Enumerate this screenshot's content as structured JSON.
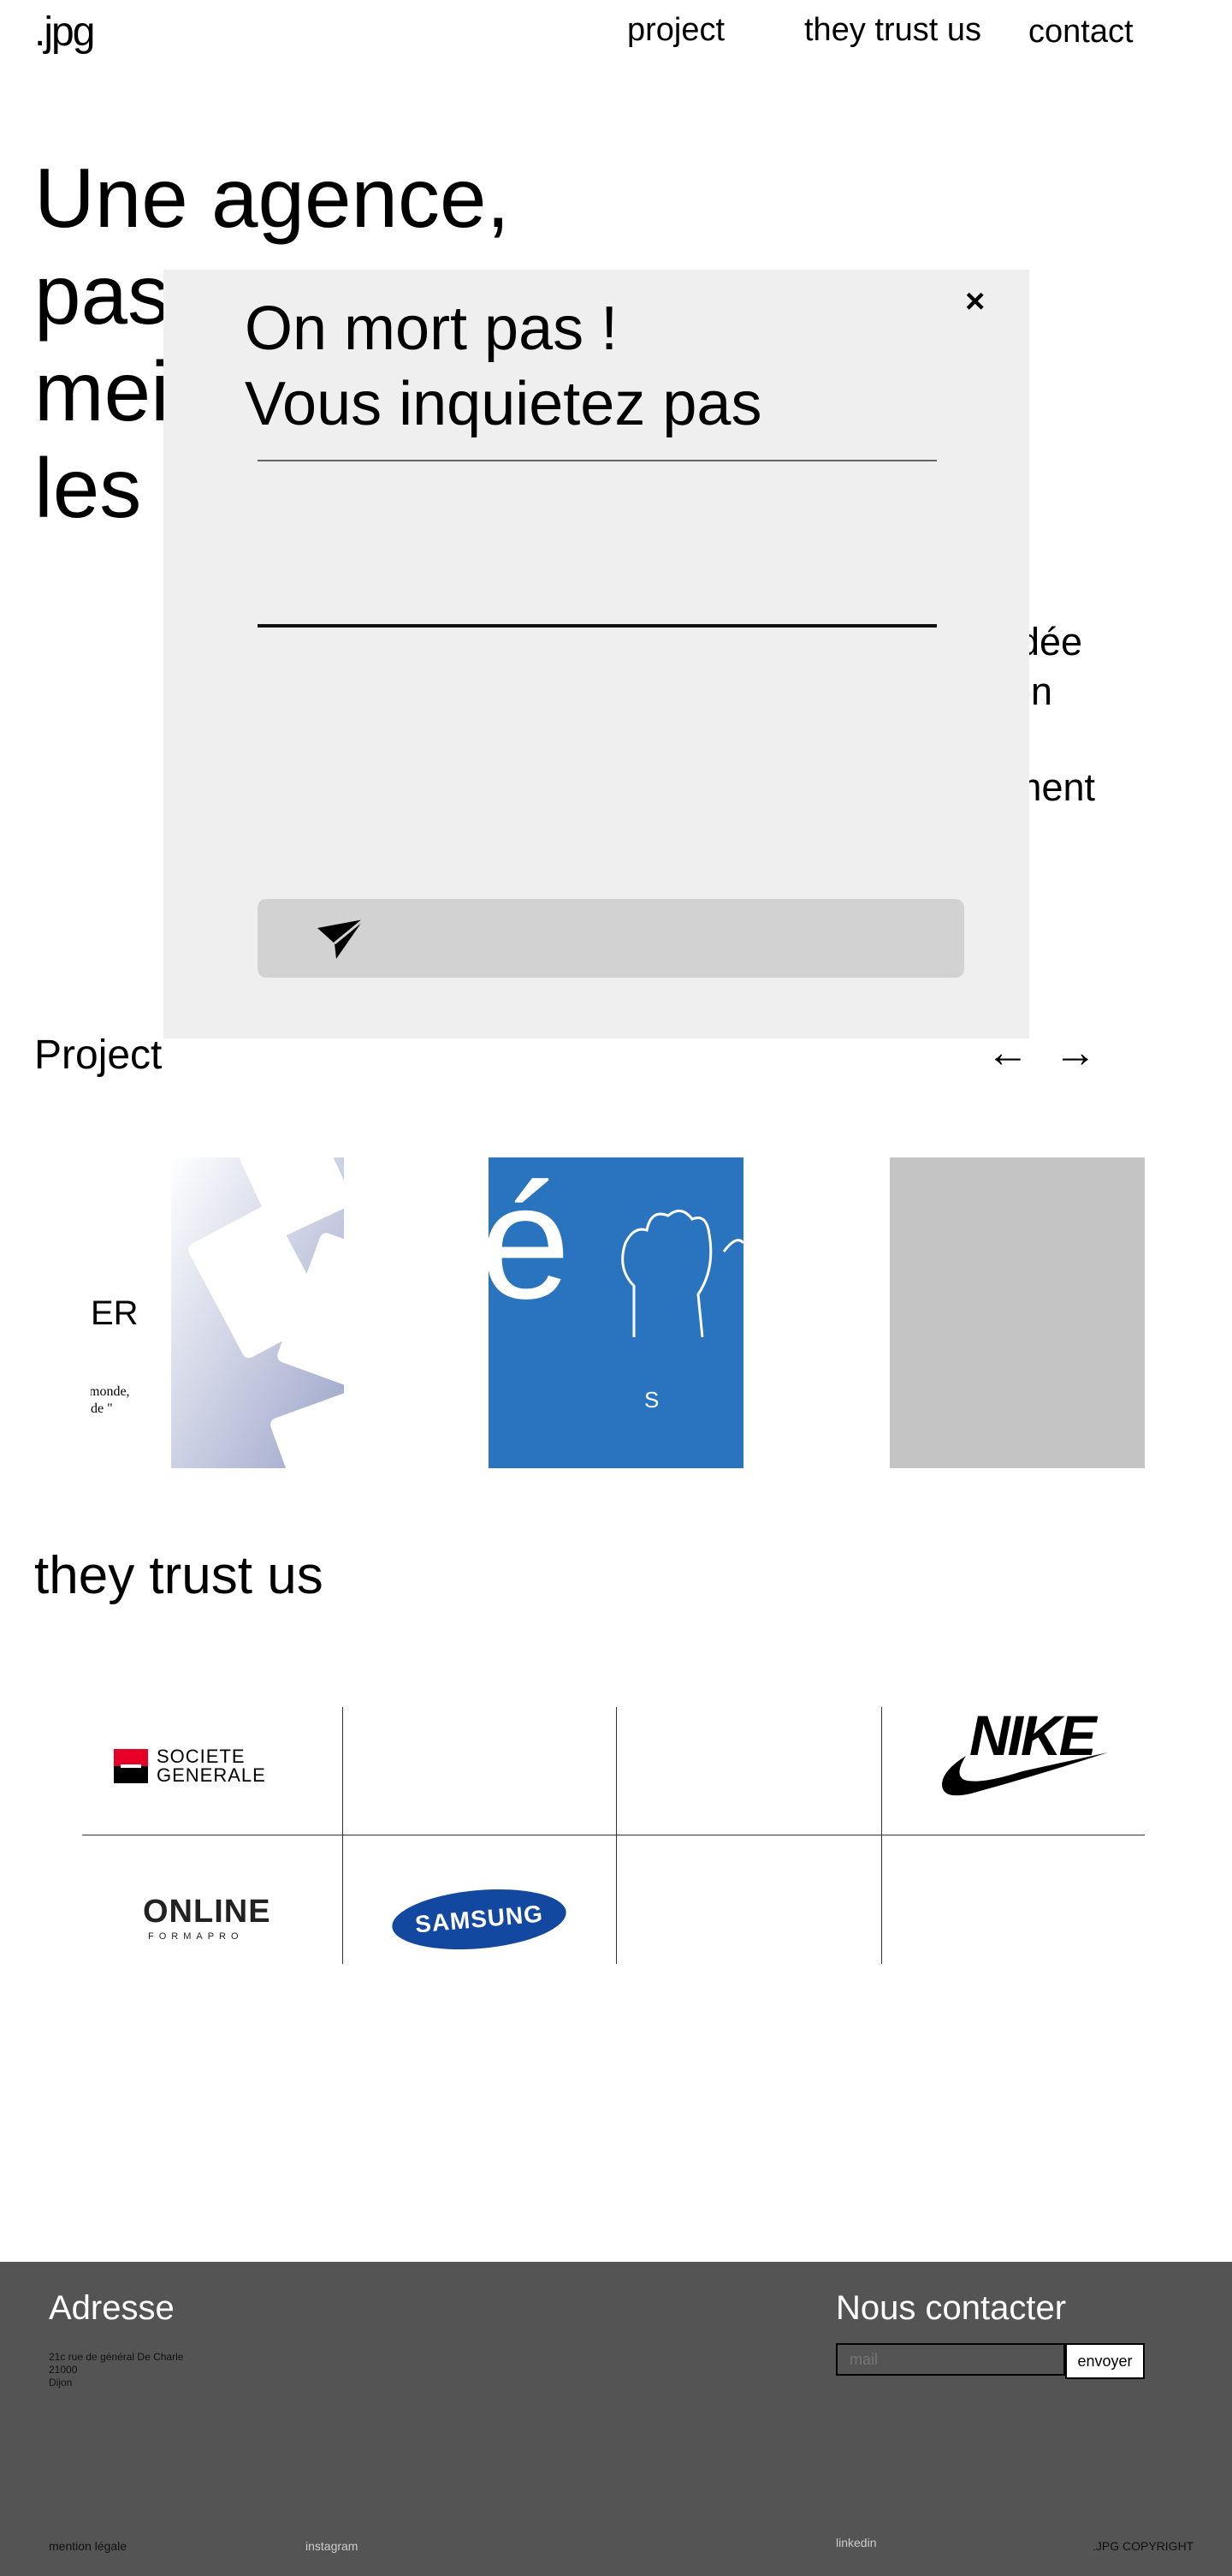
{
  "header": {
    "logo": ".jpg",
    "nav": [
      "project",
      "they trust us",
      "contact"
    ]
  },
  "hero": {
    "lines": [
      "Une agence,",
      "pas",
      "mei",
      "les"
    ],
    "side_lines": [
      "idée",
      "on",
      "ment"
    ]
  },
  "modal": {
    "title_line1": "On mort pas !",
    "title_line2": "Vous inquietez pas",
    "close": "×"
  },
  "project": {
    "title": "Project",
    "prev": "←",
    "next": "→",
    "card1_text": [
      "ER",
      "monde,",
      "de \""
    ],
    "card2_text": [
      "é",
      "S"
    ]
  },
  "trust": {
    "title": "they trust us",
    "logos": {
      "societe_generale": [
        "SOCIETE",
        "GENERALE"
      ],
      "nike": "NIKE",
      "online": "ONLINE",
      "online_sub": "FORMAPRO",
      "samsung": "SAMSUNG"
    }
  },
  "footer": {
    "address_title": "Adresse",
    "address_lines": [
      "21c rue de général De Charle",
      "21000",
      "Dijon"
    ],
    "contact_title": "Nous contacter",
    "mail_placeholder": "mail",
    "send_label": "envoyer",
    "links": [
      "mention légale",
      "instagram",
      "linkedin",
      ".JPG COPYRIGHT"
    ]
  },
  "colors": {
    "modal_bg": "#efefef",
    "footer_bg": "#545454",
    "card_blue": "#2a73bf",
    "placeholder_gray": "#c4c4c4",
    "sg_red": "#e60028",
    "samsung_blue": "#1248a0"
  }
}
